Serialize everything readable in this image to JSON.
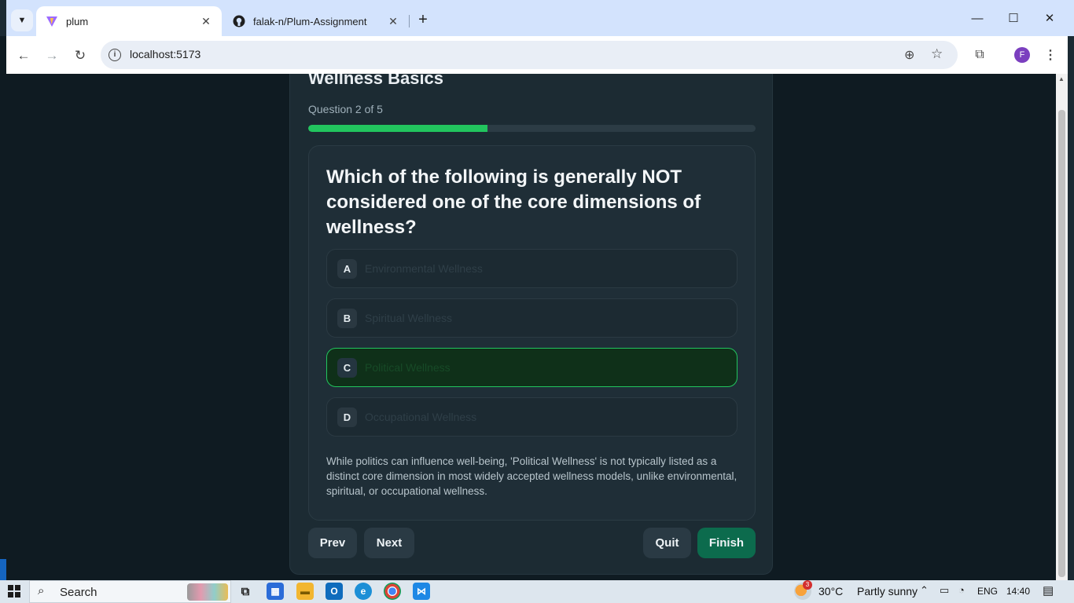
{
  "browser": {
    "tabs": [
      {
        "title": "plum",
        "active": true,
        "icon": "vite-icon"
      },
      {
        "title": "falak-n/Plum-Assignment",
        "active": false,
        "icon": "github-icon"
      }
    ],
    "new_tab_symbol": "+",
    "url": "localhost:5173",
    "profile_initial": "F",
    "window_controls": {
      "minimize": "—",
      "maximize": "☐",
      "close": "✕"
    }
  },
  "quiz": {
    "title": "Wellness Basics",
    "counter": "Question 2 of 5",
    "progress": 0.4,
    "question": "Which of the following is generally NOT considered one of the core dimensions of wellness?",
    "options": [
      {
        "letter": "A",
        "text": "Environmental Wellness",
        "selected": false
      },
      {
        "letter": "B",
        "text": "Spiritual Wellness",
        "selected": false
      },
      {
        "letter": "C",
        "text": "Political Wellness",
        "selected": true
      },
      {
        "letter": "D",
        "text": "Occupational Wellness",
        "selected": false
      }
    ],
    "explanation": "While politics can influence well-being, 'Political Wellness' is not typically listed as a distinct core dimension in most widely accepted wellness models, unlike environmental, spiritual, or occupational wellness.",
    "buttons": {
      "prev": "Prev",
      "next": "Next",
      "quit": "Quit",
      "finish": "Finish"
    }
  },
  "colors": {
    "accent_green": "#22c55e",
    "finish_button": "#0c6b4d",
    "card_bg": "#1c2b33",
    "page_bg": "#0f1b22"
  },
  "taskbar": {
    "search_label": "Search",
    "weather": {
      "temp": "30°C",
      "condition": "Partly sunny",
      "badge": "3"
    },
    "language": "ENG",
    "time": "14:40"
  }
}
